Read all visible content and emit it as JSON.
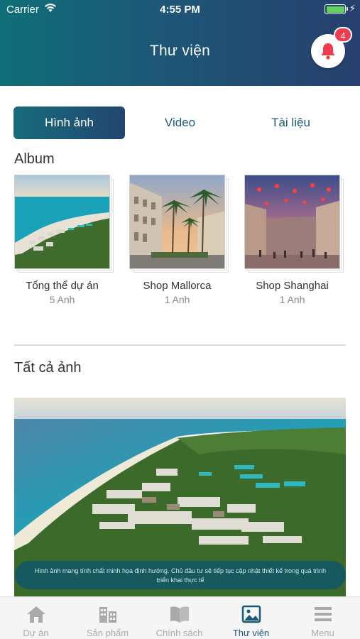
{
  "status_bar": {
    "carrier": "Carrier",
    "time": "4:55 PM"
  },
  "header": {
    "title": "Thư viện",
    "notification_count": "4"
  },
  "tabs": [
    {
      "label": "Hình ảnh",
      "active": true
    },
    {
      "label": "Video",
      "active": false
    },
    {
      "label": "Tài liệu",
      "active": false
    }
  ],
  "album_section": {
    "title": "Album"
  },
  "albums": [
    {
      "name": "Tổng thể dự án",
      "count": "5 Anh"
    },
    {
      "name": "Shop Mallorca",
      "count": "1 Anh"
    },
    {
      "name": "Shop Shanghai",
      "count": "1 Anh"
    }
  ],
  "all_photos_section": {
    "title": "Tất cả ảnh",
    "caption": "Hình ảnh mang tính chất minh họa định hướng. Chủ đầu tư sẽ tiếp tục cập nhật thiết kế trong quá trình triển khai thực tế"
  },
  "bottom_nav": [
    {
      "label": "Dự án",
      "icon": "home-icon"
    },
    {
      "label": "Sản phẩm",
      "icon": "buildings-icon"
    },
    {
      "label": "Chính sách",
      "icon": "book-icon"
    },
    {
      "label": "Thư viện",
      "icon": "image-icon",
      "active": true
    },
    {
      "label": "Menu",
      "icon": "menu-icon"
    }
  ],
  "colors": {
    "accent": "#1a5b77",
    "header_start": "#0f6f78",
    "header_end": "#27406e",
    "badge": "#ee3b4d",
    "bell": "#ee3b4d"
  }
}
